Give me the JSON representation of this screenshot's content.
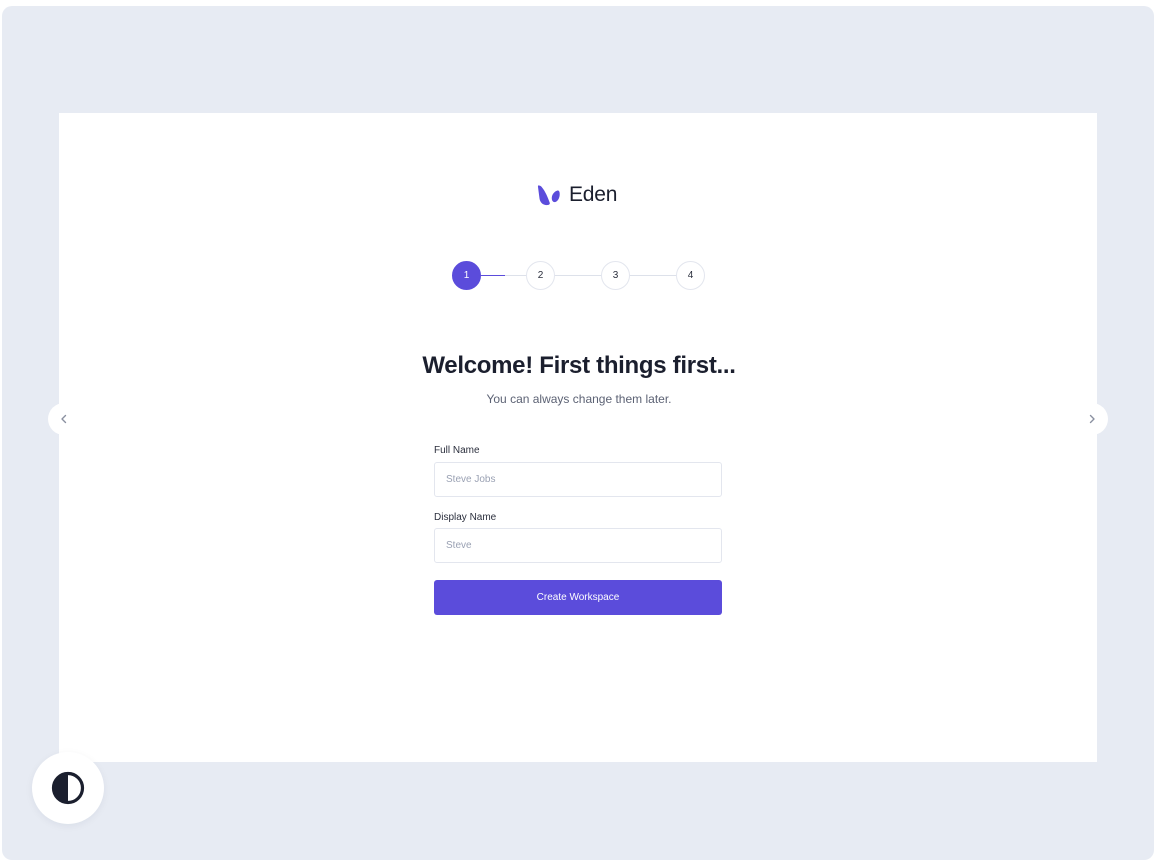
{
  "brand": {
    "name": "Eden",
    "icon": "eden-leaf-logo-icon",
    "accent_color": "#5b4cdb"
  },
  "stepper": {
    "steps": [
      {
        "label": "1",
        "state": "active"
      },
      {
        "label": "2",
        "state": "upcoming"
      },
      {
        "label": "3",
        "state": "upcoming"
      },
      {
        "label": "4",
        "state": "upcoming"
      }
    ],
    "current_step": 1
  },
  "heading": {
    "title": "Welcome! First things first...",
    "subtitle": "You can always change them later."
  },
  "form": {
    "full_name": {
      "label": "Full Name",
      "placeholder": "Steve Jobs",
      "value": ""
    },
    "display_name": {
      "label": "Display Name",
      "placeholder": "Steve",
      "value": ""
    },
    "submit_label": "Create Workspace"
  },
  "carousel": {
    "prev_icon": "chevron-left-icon",
    "next_icon": "chevron-right-icon"
  },
  "theme_toggle": {
    "icon": "contrast-half-circle-icon"
  }
}
